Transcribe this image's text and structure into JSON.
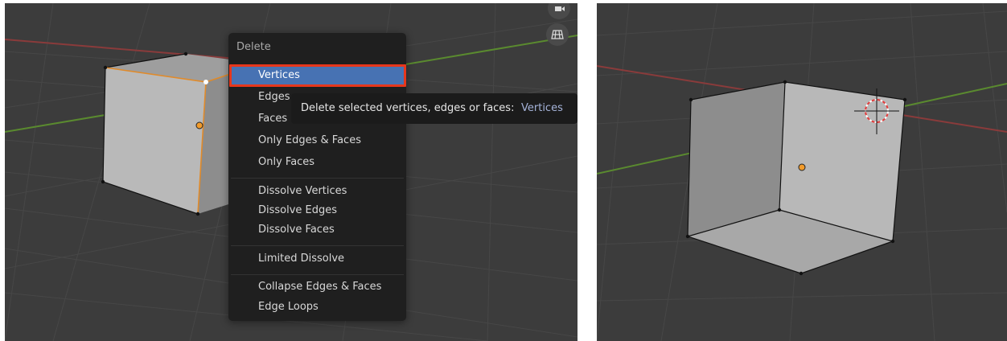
{
  "menu": {
    "title": "Delete",
    "items": [
      {
        "label": "Vertices",
        "active": true
      },
      {
        "label": "Edges",
        "active": false
      },
      {
        "label": "Faces",
        "active": false
      },
      {
        "label": "Only Edges & Faces",
        "active": false
      },
      {
        "label": "Only Faces",
        "active": false
      },
      {
        "label": "Dissolve Vertices",
        "active": false
      },
      {
        "label": "Dissolve Edges",
        "active": false
      },
      {
        "label": "Dissolve Faces",
        "active": false
      },
      {
        "label": "Limited Dissolve",
        "active": false
      },
      {
        "label": "Collapse Edges & Faces",
        "active": false
      },
      {
        "label": "Edge Loops",
        "active": false
      }
    ]
  },
  "tooltip": {
    "prefix": "Delete selected vertices, edges or faces:",
    "value": "Vertices"
  },
  "viewport_icons": [
    "camera-icon",
    "perspective-grid-icon"
  ],
  "colors": {
    "viewport_bg": "#3c3c3c",
    "menu_bg": "#1f1f1f",
    "menu_active": "#4772b3",
    "highlight_border": "#e6371c",
    "x_axis": "#8a3b3b",
    "y_axis": "#5a8a2f",
    "origin": "#f29b2b"
  }
}
